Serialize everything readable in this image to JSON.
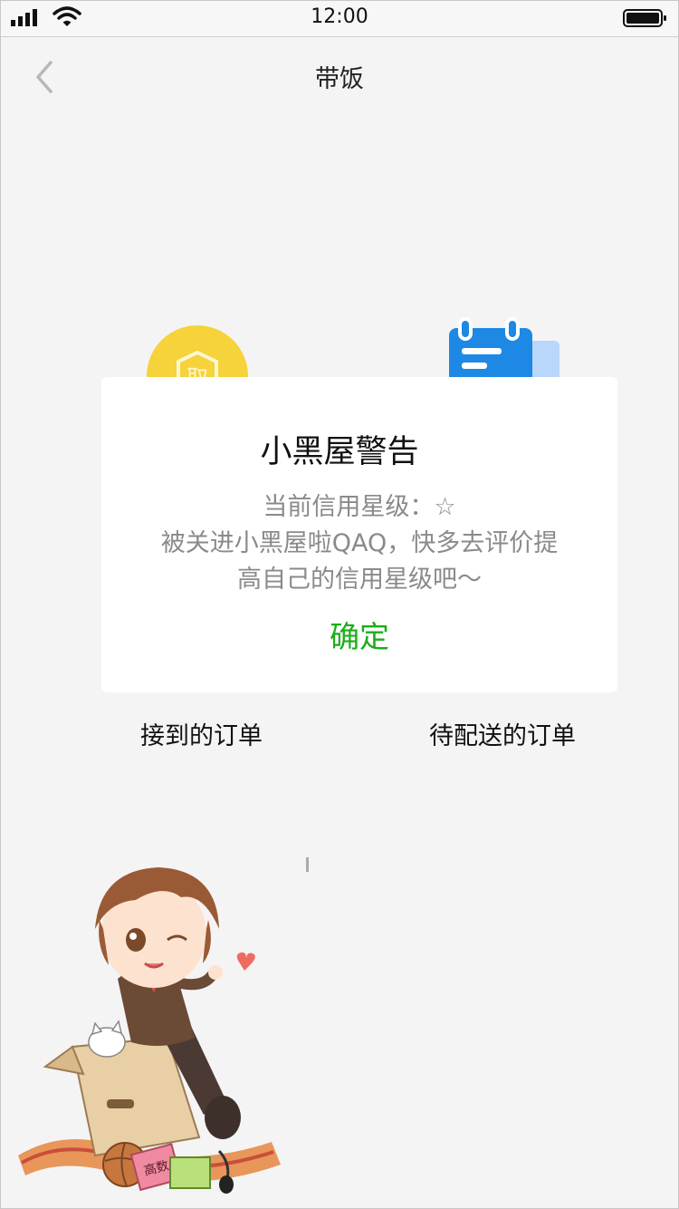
{
  "status_bar": {
    "time": "12:00"
  },
  "nav": {
    "title": "带饭"
  },
  "menu": {
    "items": [
      {
        "label": "接到的订单"
      },
      {
        "label": "待配送的订单"
      }
    ]
  },
  "badge": {
    "glyph": "取"
  },
  "dialog": {
    "title": "小黑屋警告",
    "lines": [
      "当前信用星级：☆",
      "被关进小黑屋啦QAQ，快多去评价提",
      "高自己的信用星级吧～"
    ],
    "confirm_label": "确定"
  },
  "illustration": {
    "book_text": "高数"
  },
  "colors": {
    "accent_green": "#1aad19",
    "badge_yellow": "#f6d23b",
    "calendar_blue": "#1e88e5",
    "background": "#f4f4f4"
  },
  "icons": [
    "signal-icon",
    "wifi-icon",
    "battery-icon",
    "back-arrow-icon",
    "gold-badge-icon",
    "calendar-icon"
  ]
}
